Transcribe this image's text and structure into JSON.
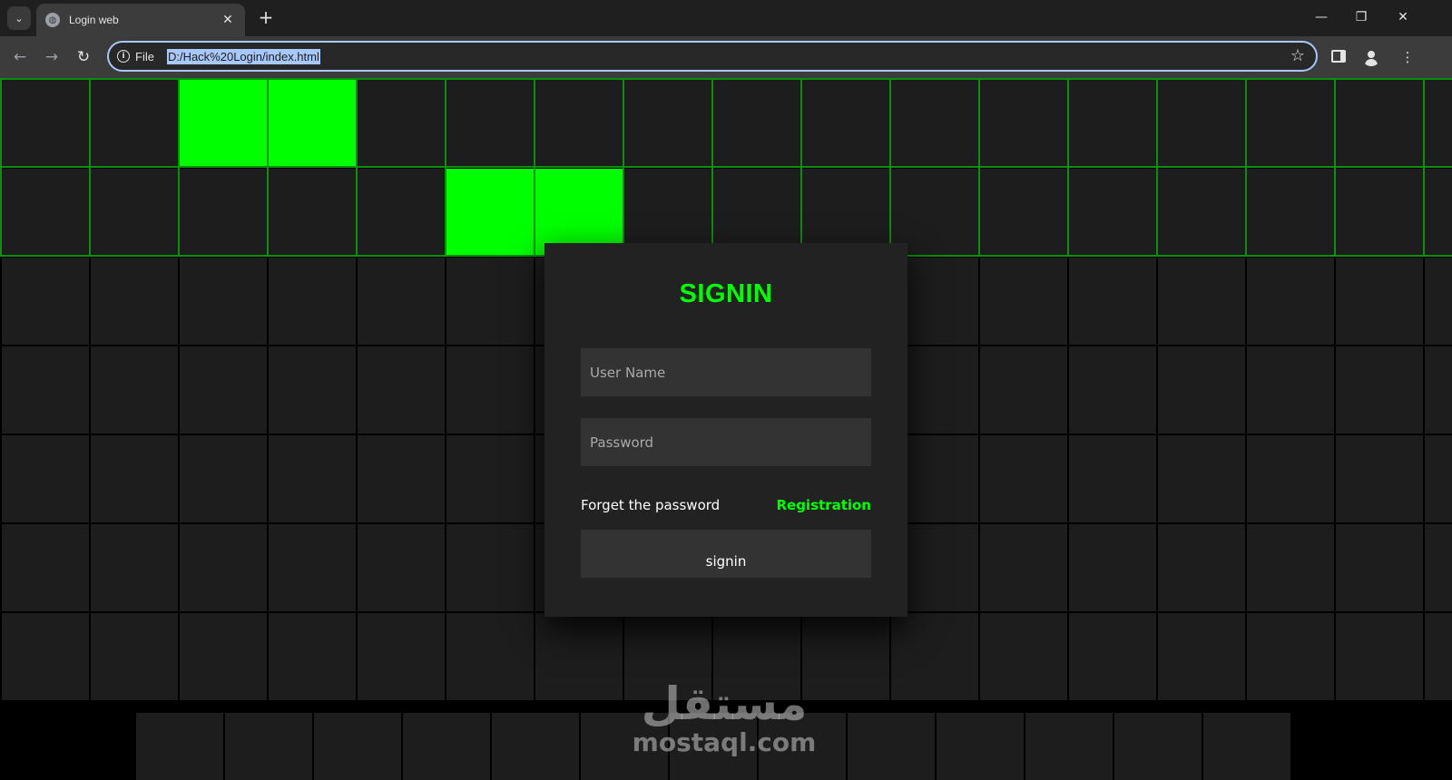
{
  "browser": {
    "tab_title": "Login web",
    "new_tab_label": "+",
    "close_tab_label": "✕",
    "scheme_label": "File",
    "url": "D:/Hack%20Login/index.html",
    "window_controls": {
      "minimize": "—",
      "restore": "❐",
      "close": "✕"
    },
    "nav": {
      "back": "←",
      "forward": "→",
      "reload": "↻",
      "bookmark": "☆",
      "menu": "⋮"
    }
  },
  "page": {
    "background_color": "#1d1d1d",
    "accent_color": "#00ff00",
    "lit_cells": [
      [
        0,
        2
      ],
      [
        0,
        3
      ],
      [
        1,
        5
      ],
      [
        1,
        6
      ]
    ]
  },
  "login": {
    "title": "SIGNIN",
    "username_placeholder": "User Name",
    "password_placeholder": "Password",
    "forget_label": "Forget the password",
    "register_label": "Registration",
    "submit_label": "signin"
  },
  "watermark": {
    "arabic": "مستقل",
    "latin": "mostaql.com"
  }
}
